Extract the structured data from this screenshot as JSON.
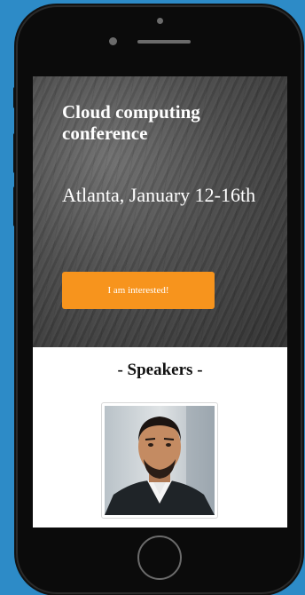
{
  "hero": {
    "title": "Cloud computing conference",
    "subtitle": "Atlanta, January 12-16th",
    "cta_label": "I am interested!"
  },
  "speakers": {
    "heading": "-  Speakers  -",
    "items": [
      {
        "photo_icon": "speaker-portrait"
      }
    ]
  },
  "colors": {
    "background": "#2d8bc7",
    "accent": "#f7941d",
    "phone": "#0b0b0b"
  }
}
